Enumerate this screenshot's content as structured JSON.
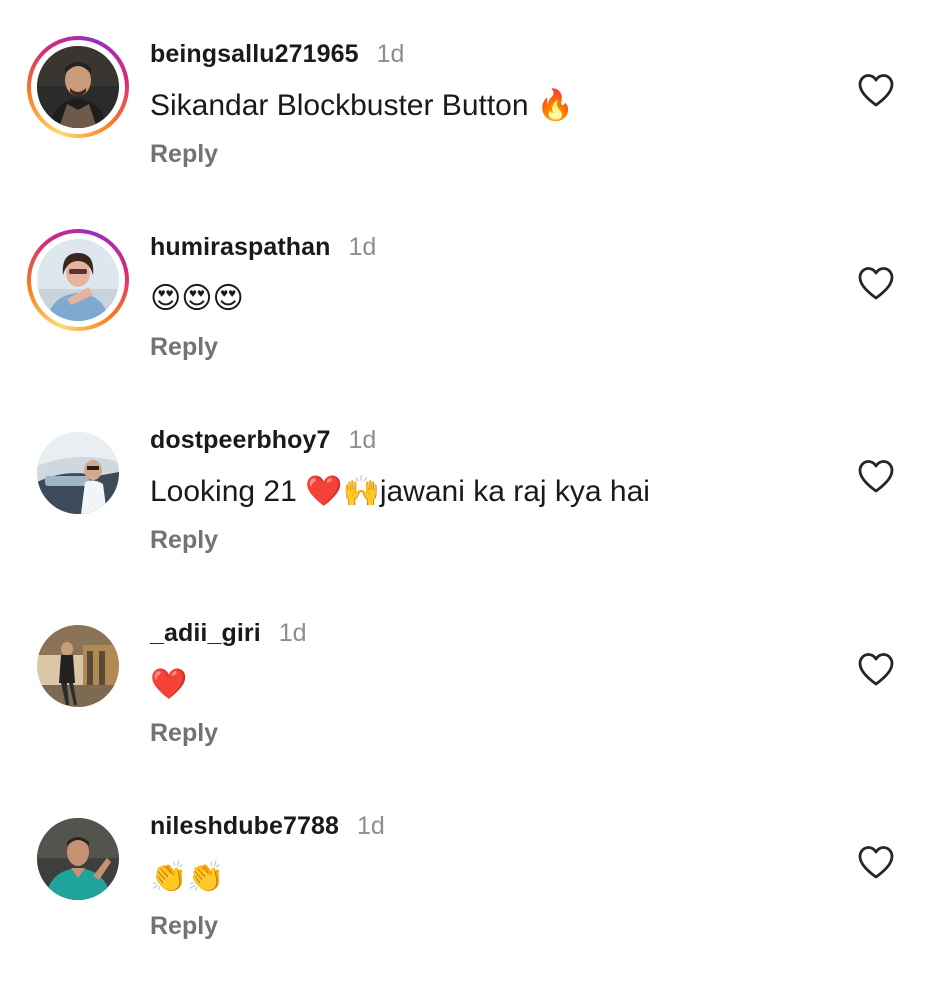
{
  "comments": [
    {
      "username": "beingsallu271965",
      "time": "1d",
      "text": "Sikandar Blockbuster Button 🔥",
      "reply_label": "Reply",
      "story_ring": true,
      "avatar_colors": [
        "#2b2b2b",
        "#6d5a4a",
        "#c99b7a"
      ]
    },
    {
      "username": "humiraspathan",
      "time": "1d",
      "text": "😍😍😍",
      "reply_label": "Reply",
      "story_ring": true,
      "avatar_colors": [
        "#dfe7ee",
        "#7fa9cf",
        "#e3b59c"
      ]
    },
    {
      "username": "dostpeerbhoy7",
      "time": "1d",
      "text": "Looking 21 ❤️🙌jawani ka raj kya hai",
      "reply_label": "Reply",
      "story_ring": false,
      "avatar_colors": [
        "#cfd8df",
        "#3c4a5a",
        "#9fb4c4"
      ]
    },
    {
      "username": "_adii_giri",
      "time": "1d",
      "text": "❤️",
      "reply_label": "Reply",
      "story_ring": false,
      "avatar_colors": [
        "#5b4a38",
        "#b08a55",
        "#d9c7a7"
      ]
    },
    {
      "username": "nileshdube7788",
      "time": "1d",
      "text": "👏👏",
      "reply_label": "Reply",
      "story_ring": false,
      "avatar_colors": [
        "#3d3f3a",
        "#1fa39a",
        "#c69273"
      ]
    }
  ],
  "colors": {
    "username": "#1a1a1a",
    "time": "#8e8e8e",
    "reply": "#737373",
    "heart_outline": "#262626"
  }
}
